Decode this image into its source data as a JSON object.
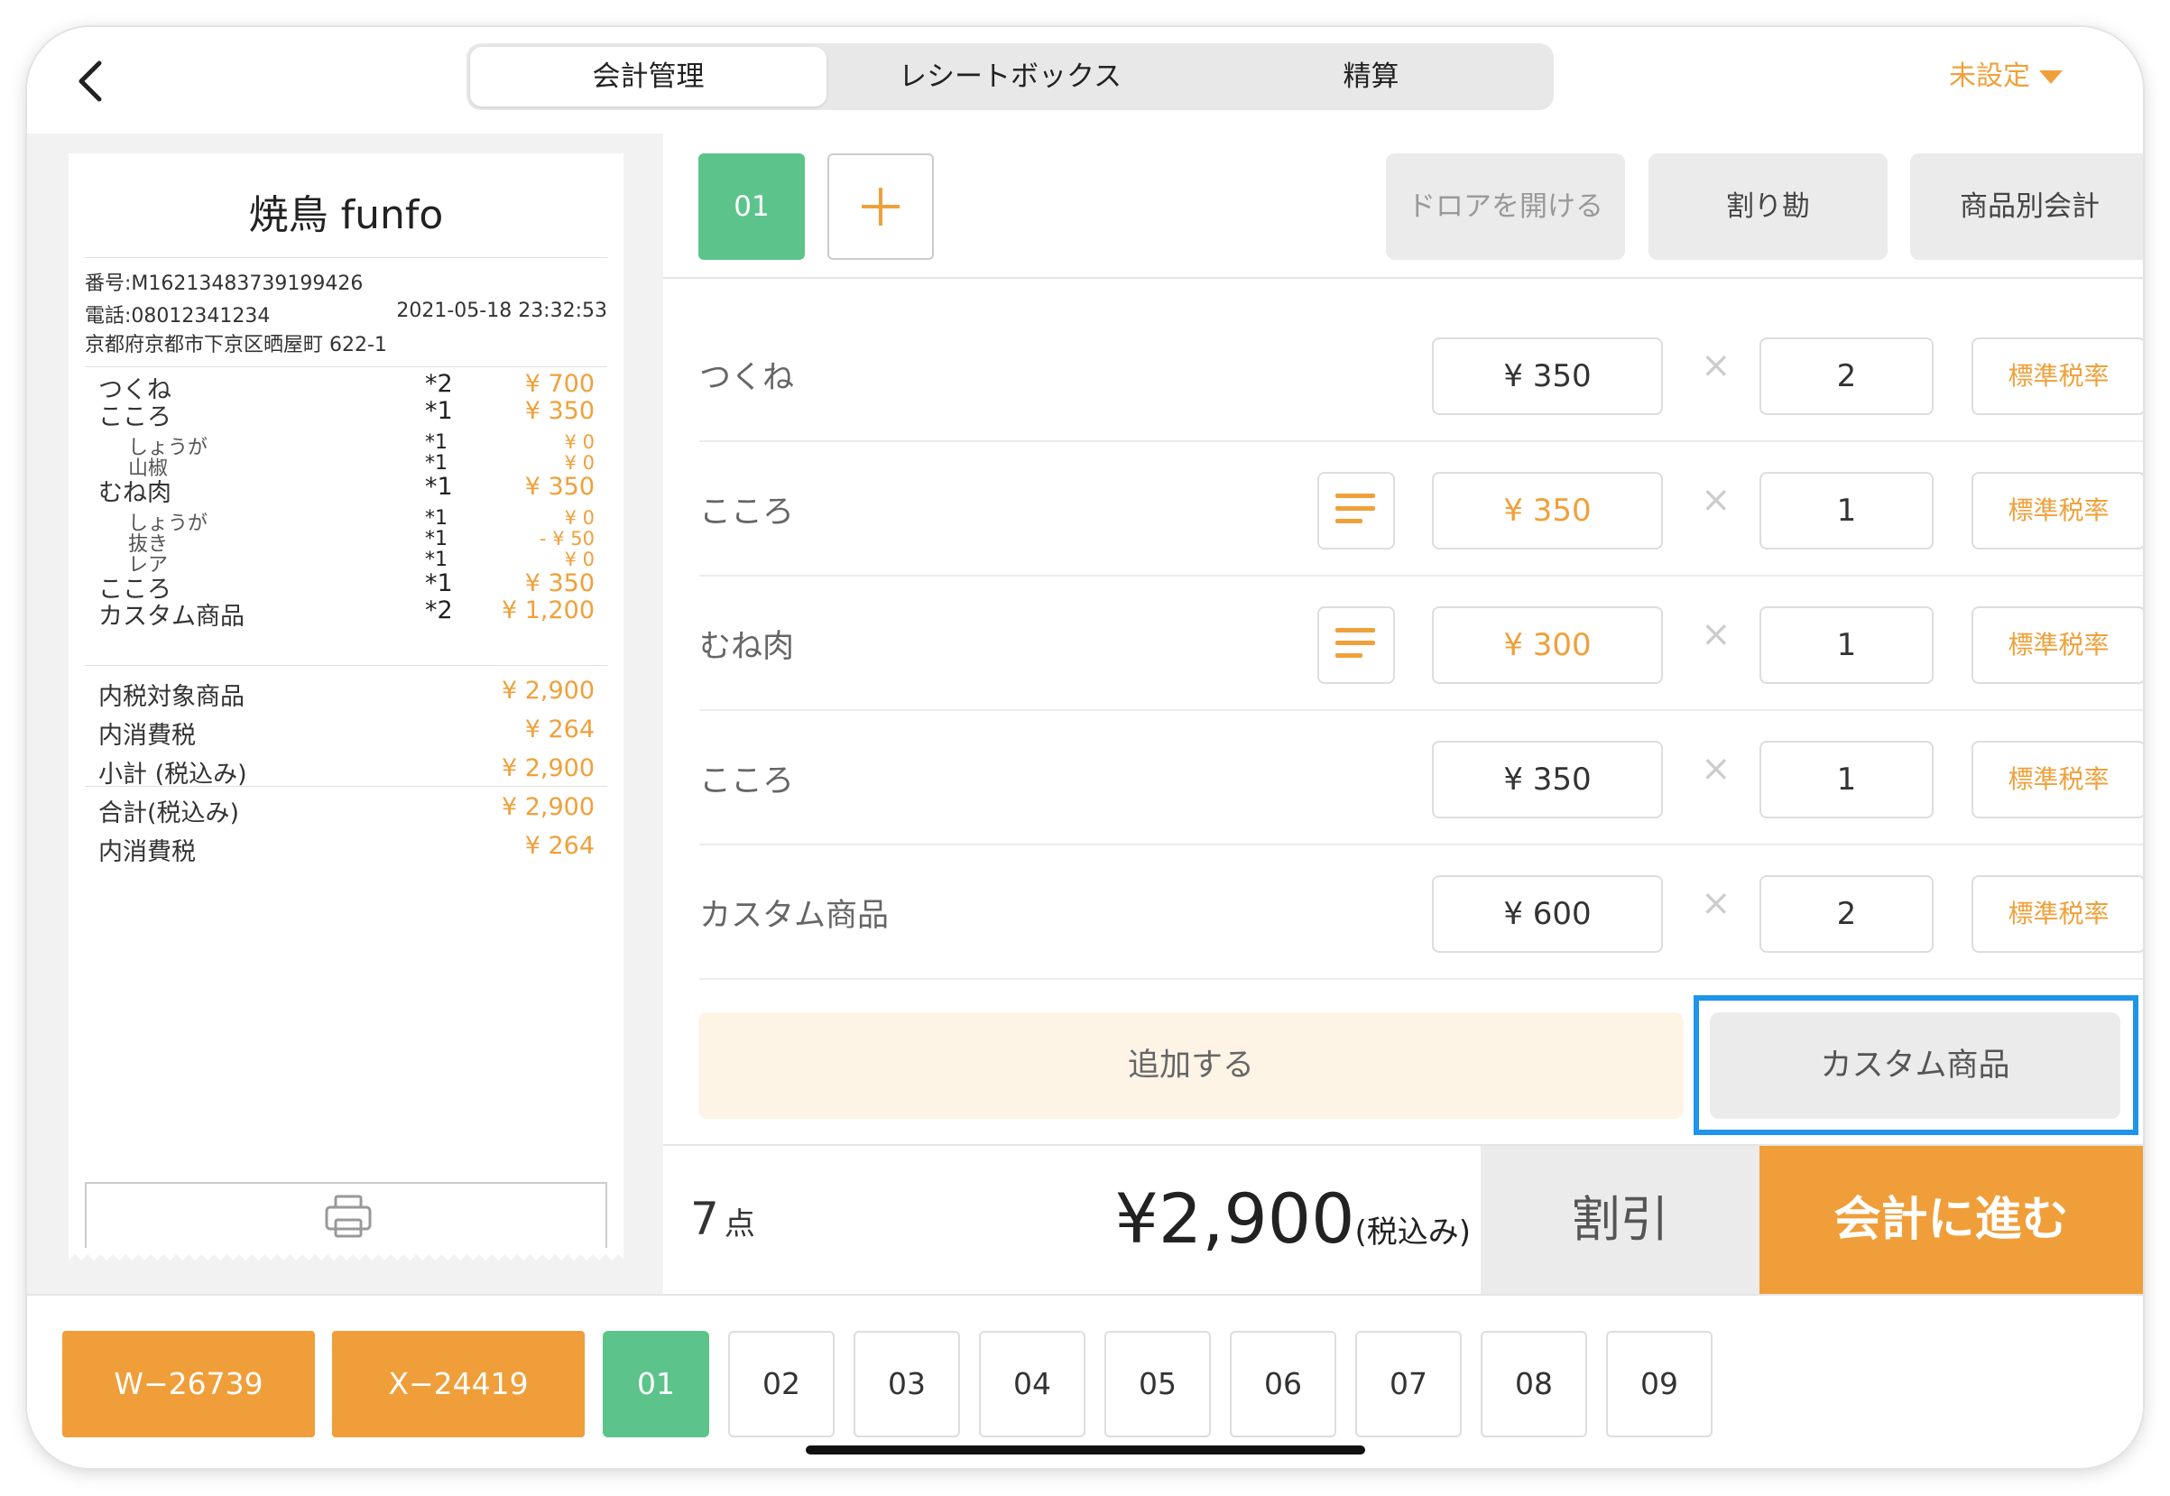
{
  "header": {
    "tabs": [
      "会計管理",
      "レシートボックス",
      "精算"
    ],
    "status": "未設定"
  },
  "receipt": {
    "shop": "焼鳥 funfo",
    "number": "番号:M16213483739199426",
    "phone": "電話:08012341234",
    "datetime": "2021-05-18 23:32:53",
    "address": "京都府京都市下京区晒屋町 622-1",
    "items": [
      {
        "name": "つくね",
        "qty": "*2",
        "price": "¥ 700",
        "sub": false
      },
      {
        "name": "こころ",
        "qty": "*1",
        "price": "¥ 350",
        "sub": false
      },
      {
        "name": "しょうが",
        "qty": "*1",
        "price": "¥ 0",
        "sub": true
      },
      {
        "name": "山椒",
        "qty": "*1",
        "price": "¥ 0",
        "sub": true
      },
      {
        "name": "むね肉",
        "qty": "*1",
        "price": "¥ 350",
        "sub": false
      },
      {
        "name": "しょうが",
        "qty": "*1",
        "price": "¥ 0",
        "sub": true
      },
      {
        "name": "抜き",
        "qty": "*1",
        "price": "- ¥ 50",
        "sub": true
      },
      {
        "name": "レア",
        "qty": "*1",
        "price": "¥ 0",
        "sub": true
      },
      {
        "name": "こころ",
        "qty": "*1",
        "price": "¥ 350",
        "sub": false
      },
      {
        "name": "カスタム商品",
        "qty": "*2",
        "price": "¥ 1,200",
        "sub": false
      }
    ],
    "summary": [
      {
        "label": "内税対象商品",
        "value": "¥ 2,900"
      },
      {
        "label": "内消費税",
        "value": "¥ 264"
      },
      {
        "label": "小計 (税込み)",
        "value": "¥ 2,900"
      },
      {
        "label": "合計(税込み)",
        "value": "¥ 2,900"
      },
      {
        "label": "内消費税",
        "value": "¥ 264"
      }
    ]
  },
  "toolbar": {
    "order_tab": "01",
    "drawer": "ドロアを開ける",
    "split": "割り勘",
    "by_item": "商品別会計"
  },
  "order_items": [
    {
      "name": "つくね",
      "price": "¥ 350",
      "qty": "2",
      "tax": "標準税率",
      "has_note": false,
      "price_orange": false
    },
    {
      "name": "こころ",
      "price": "¥ 350",
      "qty": "1",
      "tax": "標準税率",
      "has_note": true,
      "price_orange": true
    },
    {
      "name": "むね肉",
      "price": "¥ 300",
      "qty": "1",
      "tax": "標準税率",
      "has_note": true,
      "price_orange": true
    },
    {
      "name": "こころ",
      "price": "¥ 350",
      "qty": "1",
      "tax": "標準税率",
      "has_note": false,
      "price_orange": false
    },
    {
      "name": "カスタム商品",
      "price": "¥ 600",
      "qty": "2",
      "tax": "標準税率",
      "has_note": false,
      "price_orange": false
    }
  ],
  "actions": {
    "add": "追加する",
    "custom": "カスタム商品"
  },
  "totals": {
    "count": "7",
    "count_unit": "点",
    "total": "¥2,900",
    "tax_note": "(税込み)",
    "discount": "割引",
    "checkout": "会計に進む"
  },
  "bottom": {
    "tickets": [
      "W−26739",
      "X−24419"
    ],
    "tables": [
      "01",
      "02",
      "03",
      "04",
      "05",
      "06",
      "07",
      "08",
      "09"
    ],
    "active_table": "01"
  },
  "colors": {
    "accent_orange": "#f09e39",
    "accent_green": "#5cc48a",
    "highlight_blue": "#1e95ea"
  }
}
